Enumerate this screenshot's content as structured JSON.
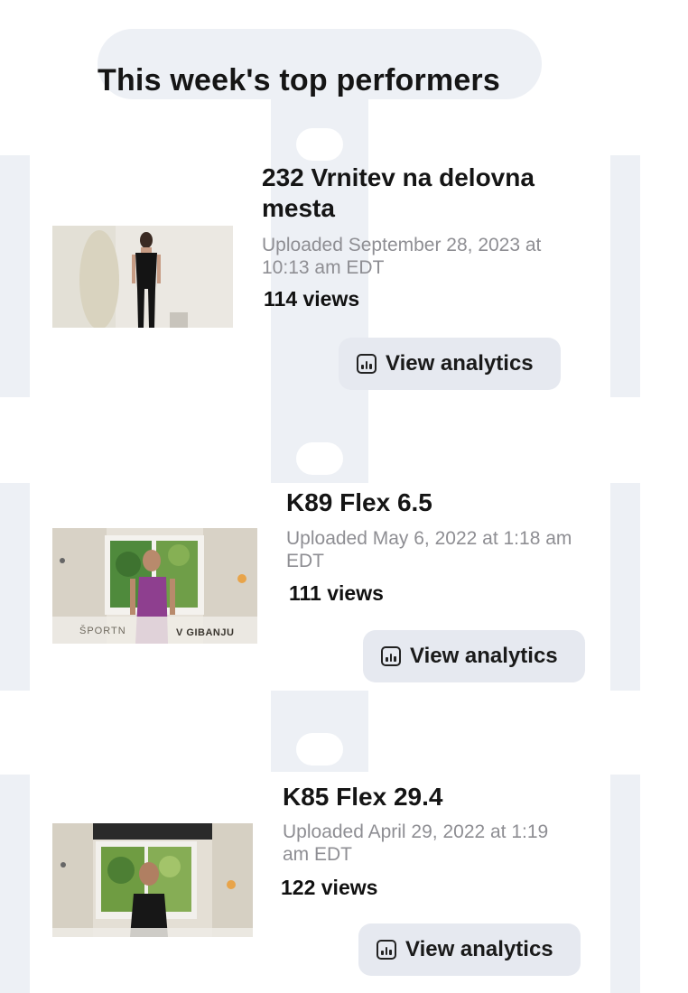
{
  "header": {
    "title": "This week's top performers"
  },
  "videos": [
    {
      "title": "232 Vrnitev na delovna mesta",
      "uploaded": "Uploaded September 28, 2023 at 10:13 am EDT",
      "views": "114 views",
      "button_label": "View analytics"
    },
    {
      "title": "K89 Flex 6.5",
      "uploaded": "Uploaded May 6, 2022 at 1:18 am EDT",
      "views": "111 views",
      "button_label": "View analytics",
      "thumbnail_caption_left": "ŠPORTN",
      "thumbnail_caption_right": "V GIBANJU"
    },
    {
      "title": "K85 Flex 29.4",
      "uploaded": "Uploaded April 29, 2022 at 1:19 am EDT",
      "views": "122 views",
      "button_label": "View analytics"
    }
  ],
  "icons": {
    "analytics": "bar-chart-icon"
  }
}
